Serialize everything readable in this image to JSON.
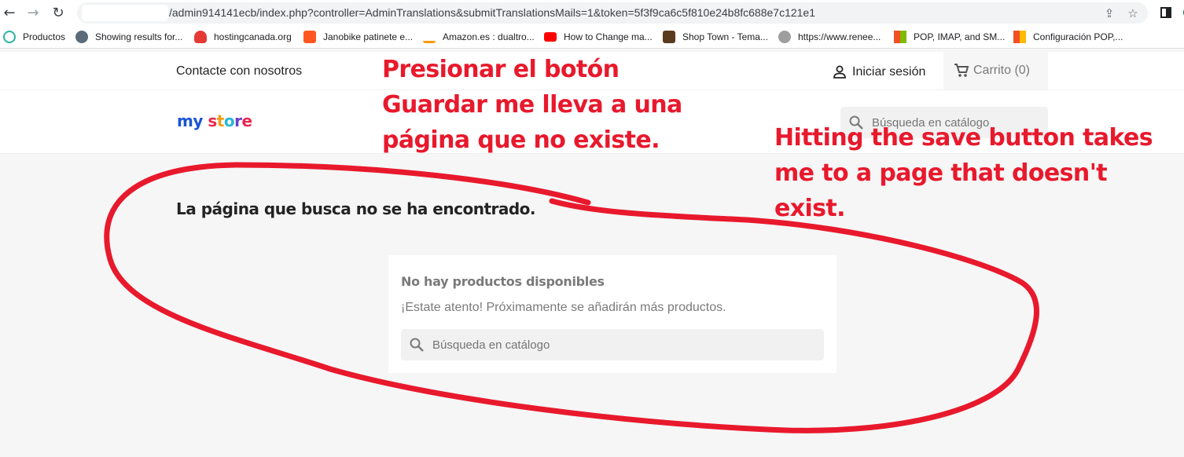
{
  "browser": {
    "url": "/admin914141ecb/index.php?controller=AdminTranslations&submitTranslationsMails=1&token=5f3f9ca6c5f810e24b8fc688e7c121e1",
    "bookmarks": [
      {
        "label": "Productos",
        "color": "#2bb3a5"
      },
      {
        "label": "Showing results for...",
        "color": "#5b6b7a"
      },
      {
        "label": "hostingcanada.org",
        "color": "#e53935"
      },
      {
        "label": "Janobike patinete e...",
        "color": "#ff5722"
      },
      {
        "label": "Amazon.es : dualtro...",
        "color": "#222222"
      },
      {
        "label": "How to Change ma...",
        "color": "#ff0000"
      },
      {
        "label": "Shop Town - Tema...",
        "color": "#5a3b1f"
      },
      {
        "label": "https://www.renee...",
        "color": "#444444"
      },
      {
        "label": "POP, IMAP, and SM...",
        "color": "#f25022"
      },
      {
        "label": "Configuración POP,...",
        "color": "#f25022"
      }
    ]
  },
  "header": {
    "contact": "Contacte con nosotros",
    "signin": "Iniciar sesión",
    "cart": "Carrito (0)",
    "logo": {
      "my": "my",
      "store": [
        "s",
        "t",
        "o",
        "r",
        "e"
      ]
    },
    "search_placeholder": "Búsqueda en catálogo"
  },
  "main": {
    "title": "La página que busca no se ha encontrado.",
    "empty_title": "No hay productos disponibles",
    "empty_text": "¡Estate atento! Próximamente se añadirán más productos.",
    "search_placeholder": "Búsqueda en catálogo"
  },
  "annotations": {
    "spanish": [
      "Presionar el botón",
      "Guardar me lleva a una",
      "página que no existe."
    ],
    "english": [
      "Hitting the save button takes",
      "me to a page that doesn't",
      "exist."
    ],
    "color": "#e8192c"
  }
}
